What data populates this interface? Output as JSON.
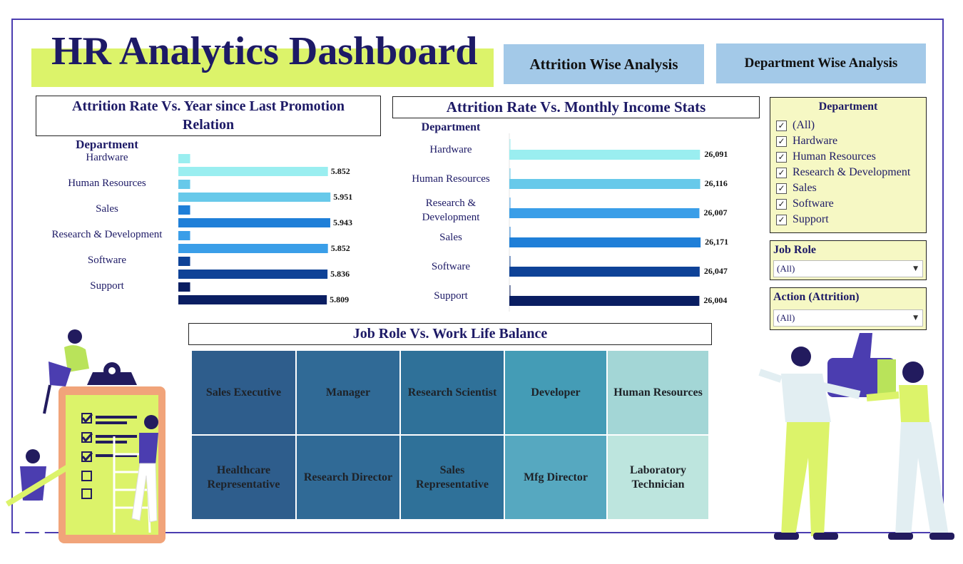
{
  "header": {
    "title": "HR Analytics Dashboard",
    "nav_buttons": [
      "Attrition Wise Analysis",
      "Department Wise Analysis"
    ]
  },
  "chart1": {
    "title_line1": "Attrition Rate Vs. Year since Last Promotion",
    "title_line2": "Relation",
    "dept_label": "Department",
    "categories": [
      "Hardware",
      "Human Resources",
      "Sales",
      "Research & Development",
      "Software",
      "Support"
    ],
    "value_labels": [
      "5.852",
      "5.951",
      "5.943",
      "5.852",
      "5.836",
      "5.809"
    ]
  },
  "chart2": {
    "title": "Attrition Rate Vs. Monthly Income Stats",
    "dept_label": "Department",
    "categories": [
      "Hardware",
      "Human Resources",
      "Research & Development",
      "Sales",
      "Software",
      "Support"
    ],
    "value_labels": [
      "26,091",
      "26,116",
      "26,007",
      "26,171",
      "26,047",
      "26,004"
    ]
  },
  "chart3": {
    "title": "Job Role Vs. Work Life Balance"
  },
  "filters": {
    "department": {
      "title": "Department",
      "options": [
        "(All)",
        "Hardware",
        "Human Resources",
        "Research & Development",
        "Sales",
        "Software",
        "Support"
      ],
      "checked": [
        true,
        true,
        true,
        true,
        true,
        true,
        true
      ]
    },
    "job_role": {
      "title": "Job Role",
      "value": "(All)"
    },
    "attrition": {
      "title": "Action (Attrition)",
      "value": "(All)"
    }
  },
  "chart_data": [
    {
      "type": "bar",
      "title": "Attrition Rate Vs. Year since Last Promotion Relation",
      "ylabel": "Department",
      "categories": [
        "Hardware",
        "Human Resources",
        "Sales",
        "Research & Development",
        "Software",
        "Support"
      ],
      "series": [
        {
          "values": [
            0.5,
            0.5,
            0.5,
            0.5,
            0.5,
            0.5
          ]
        },
        {
          "values": [
            5.852,
            5.951,
            5.943,
            5.852,
            5.836,
            5.809
          ]
        }
      ],
      "xlim": [
        0,
        6.5
      ],
      "colors": [
        "#9aeef0",
        "#67c9ea",
        "#1f7fd8",
        "#3a9ee8",
        "#0e4297",
        "#0a1e62"
      ],
      "grid": false
    },
    {
      "type": "bar",
      "title": "Attrition Rate Vs. Monthly Income Stats",
      "ylabel": "Department",
      "categories": [
        "Hardware",
        "Human Resources",
        "Research & Development",
        "Sales",
        "Software",
        "Support"
      ],
      "series": [
        {
          "values": [
            0,
            0,
            0,
            0,
            0,
            0
          ]
        },
        {
          "values": [
            26091,
            26116,
            26007,
            26171,
            26047,
            26004
          ]
        }
      ],
      "xlim": [
        0,
        28500
      ],
      "colors": [
        "#9aeef0",
        "#67c9ea",
        "#3a9ee8",
        "#1f7fd8",
        "#0e4297",
        "#0a1e62"
      ],
      "grid": false
    },
    {
      "type": "heatmap",
      "title": "Job Role Vs. Work Life Balance",
      "rows": [
        [
          "Sales Executive",
          "Manager",
          "Research Scientist",
          "Developer",
          "Human Resources"
        ],
        [
          "Healthcare Representative",
          "Research Director",
          "Sales Representative",
          "Mfg Director",
          "Laboratory Technician"
        ]
      ],
      "colors": [
        [
          "#2e5d8c",
          "#306a96",
          "#2f7199",
          "#449cb6",
          "#a3d6d6"
        ],
        [
          "#2e5d8c",
          "#306a96",
          "#2f7199",
          "#56a8c0",
          "#bde5de"
        ]
      ]
    }
  ]
}
